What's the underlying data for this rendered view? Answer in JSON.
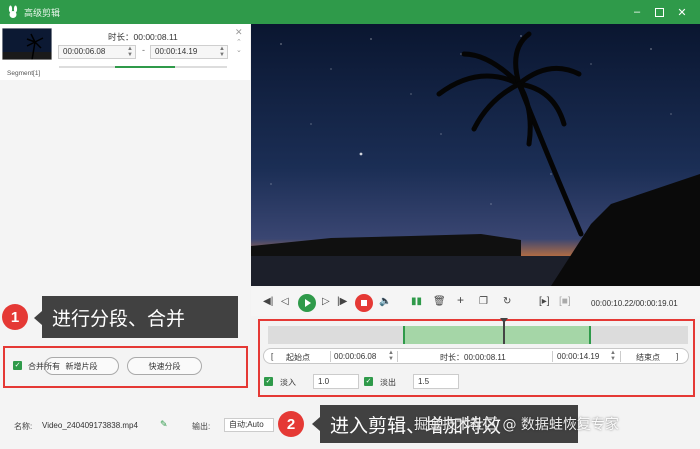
{
  "window": {
    "title": "高级剪辑",
    "icon": "rabbit-logo-icon",
    "buttons": [
      "minimize",
      "maximize",
      "close"
    ]
  },
  "segment": {
    "duration_label": "时长：00:00:08.11",
    "start_time": "00:00:06.08",
    "end_time": "00:00:14.19",
    "label": "Segment[1]"
  },
  "left_actions": {
    "new_segment": "新增片段",
    "quick_split": "快速分段",
    "merge_all": "合并所有",
    "merge_all_checked": true
  },
  "file": {
    "name_label": "名称:",
    "name_value": "Video_240409173838.mp4",
    "output_label": "输出:",
    "output_value": "自动;Auto"
  },
  "player": {
    "time_readout": "00:00:10.22/00:00:19.01"
  },
  "trim": {
    "start_point_label": "起始点",
    "start_time": "00:00:06.08",
    "duration_label": "时长：00:00:08.11",
    "end_time": "00:00:14.19",
    "end_point_label": "结束点",
    "fade_in_label": "淡入",
    "fade_in_value": "1.0",
    "fade_out_label": "淡出",
    "fade_out_value": "1.5"
  },
  "annotations": {
    "badge1": "1",
    "tip1": "进行分段、合并",
    "badge2": "2",
    "tip2": "进入剪辑、增加特效"
  },
  "watermark": "掘金技术社区 @ 数据蛙恢复专家",
  "colors": {
    "accent": "#2f9a4a",
    "highlight": "#e53935",
    "selection": "#a5d6a7"
  }
}
